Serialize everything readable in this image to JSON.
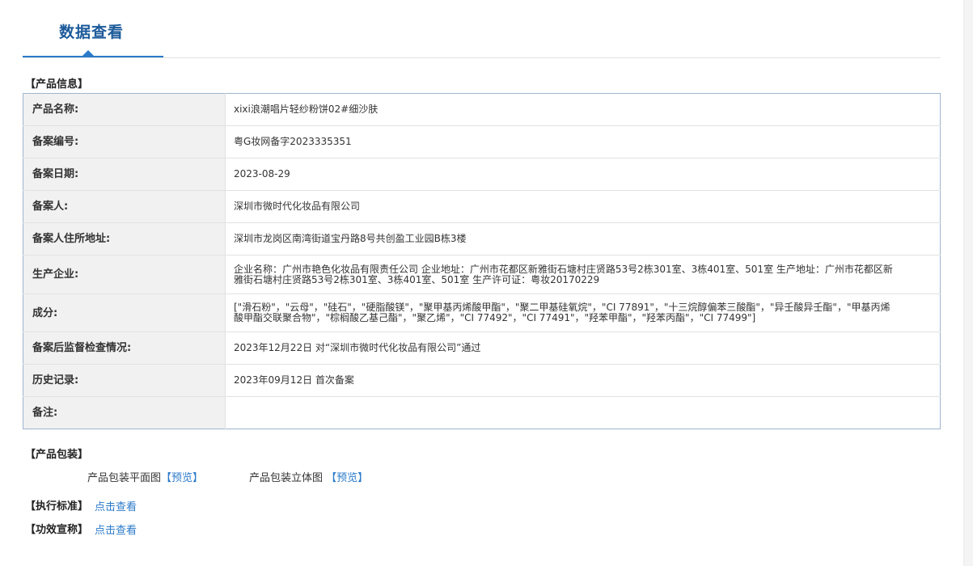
{
  "page": {
    "tab_title": "数据查看"
  },
  "product_info": {
    "section_title": "【产品信息】",
    "rows": [
      {
        "label": "产品名称:",
        "value": "xixi浪潮唱片轻纱粉饼02#细沙肤"
      },
      {
        "label": "备案编号:",
        "value": "粤G妆网备字2023335351"
      },
      {
        "label": "备案日期:",
        "value": "2023-08-29"
      },
      {
        "label": "备案人:",
        "value": "深圳市微时代化妆品有限公司"
      },
      {
        "label": "备案人住所地址:",
        "value": "深圳市龙岗区南湾街道宝丹路8号共创盈工业园B栋3楼"
      },
      {
        "label": "生产企业:",
        "value": "企业名称：广州市艳色化妆品有限责任公司 企业地址：广州市花都区新雅街石塘村庄贤路53号2栋301室、3栋401室、501室 生产地址：广州市花都区新雅街石塘村庄贤路53号2栋301室、3栋401室、501室 生产许可证：粤妆20170229"
      },
      {
        "label": "成分:",
        "value": "[\"滑石粉\"，\"云母\"，\"硅石\"，\"硬脂酸镁\"，\"聚甲基丙烯酸甲酯\"，\"聚二甲基硅氧烷\"，\"CI 77891\"，\"十三烷醇偏苯三酸酯\"，\"异壬酸异壬酯\"，\"甲基丙烯酸甲酯交联聚合物\"，\"棕榈酸乙基己酯\"，\"聚乙烯\"，\"CI 77492\"，\"CI 77491\"，\"羟苯甲酯\"，\"羟苯丙酯\"，\"CI 77499\"]"
      },
      {
        "label": "备案后监督检查情况:",
        "value": "2023年12月22日 对“深圳市微时代化妆品有限公司”通过"
      },
      {
        "label": "历史记录:",
        "value": "2023年09月12日 首次备案"
      },
      {
        "label": "备注:",
        "value": ""
      }
    ]
  },
  "packaging": {
    "section_title": "【产品包装】",
    "flat_label": "产品包装平面图",
    "flat_link": "【预览】",
    "solid_label": "产品包装立体图 ",
    "solid_link": "【预览】"
  },
  "standard": {
    "section_title": "【执行标准】",
    "link": "点击查看"
  },
  "efficacy": {
    "section_title": "【功效宣称】",
    "link": "点击查看"
  },
  "colors": {
    "accent": "#2b7ac9",
    "title": "#1c5a9a",
    "table_border": "#9fb6cf",
    "label_bg": "#f1f1f1"
  }
}
